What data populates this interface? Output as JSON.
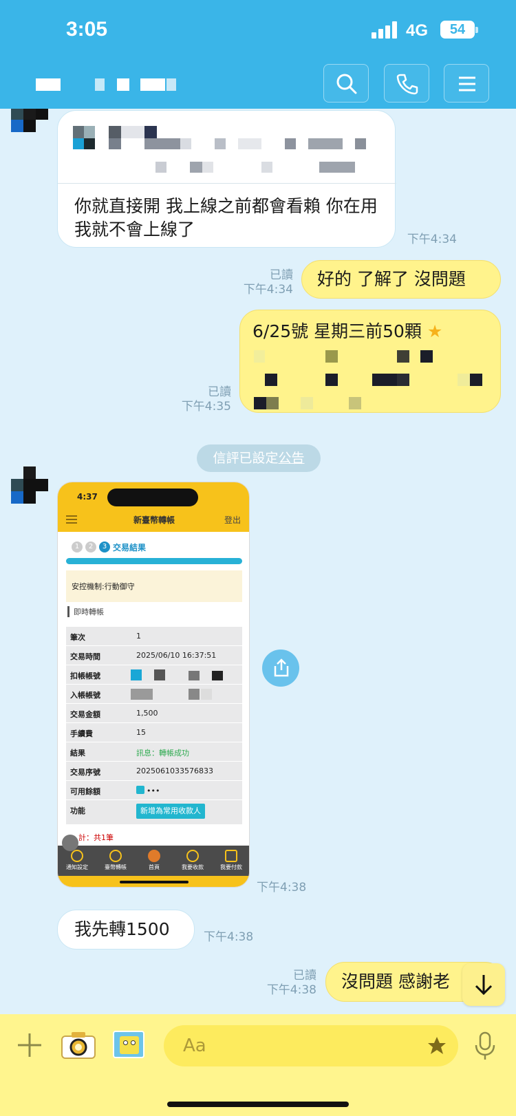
{
  "status_bar": {
    "time": "3:05",
    "network": "4G",
    "battery": "54"
  },
  "colors": {
    "header": "#3ab5e8",
    "chat_bg": "#dff1fb",
    "outgoing": "#fff38c",
    "incoming": "#ffffff",
    "input_bar": "#fff58e"
  },
  "header": {
    "icons": [
      "search-icon",
      "phone-icon",
      "menu-icon"
    ]
  },
  "messages": {
    "m1": {
      "text": "你就直接開 我上線之前都會看賴 你在用我就不會上線了",
      "time": "下午4:34"
    },
    "m2": {
      "text": "好的 了解了 沒問題",
      "read": "已讀",
      "time": "下午4:34"
    },
    "m3": {
      "text": "6/25號 星期三前50顆",
      "read": "已讀",
      "time": "下午4:35"
    },
    "m4": {
      "notice_prefix": "信評已設定",
      "notice_link": "公告"
    },
    "m5": {
      "time": "下午4:38"
    },
    "m6": {
      "text": "我先轉1500",
      "time": "下午4:38"
    },
    "m7": {
      "text": "沒問題 感謝老",
      "read": "已讀",
      "time": "下午4:38"
    }
  },
  "screenshot": {
    "time": "4:37",
    "title": "新臺幣轉帳",
    "logout": "登出",
    "steps": [
      "1",
      "2",
      "3"
    ],
    "step_label": "交易結果",
    "section": "安控機制:行動御守",
    "subsection": "即時轉帳",
    "rows": [
      {
        "k": "筆次",
        "v": "1"
      },
      {
        "k": "交易時間",
        "v": "2025/06/10 16:37:51"
      },
      {
        "k": "扣帳帳號",
        "v": ""
      },
      {
        "k": "入帳帳號",
        "v": ""
      },
      {
        "k": "交易金額",
        "v": "1,500"
      },
      {
        "k": "手續費",
        "v": "15"
      },
      {
        "k": "結果",
        "v": "訊息：轉帳成功"
      },
      {
        "k": "交易序號",
        "v": "2025061033576833"
      },
      {
        "k": "可用餘額",
        "v": "•••"
      },
      {
        "k": "功能",
        "v": "新增為常用收款人"
      }
    ],
    "total": "計：共1筆",
    "nav": [
      "通知設定",
      "臺幣轉帳",
      "首頁",
      "我要收款",
      "我要付款"
    ]
  },
  "input": {
    "placeholder": "Aa"
  }
}
